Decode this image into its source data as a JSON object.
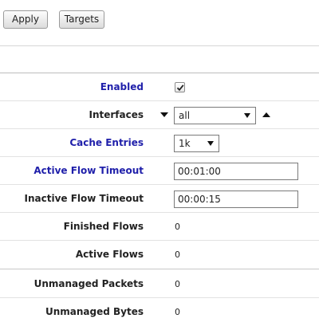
{
  "toolbar": {
    "apply_label": "Apply",
    "targets_label": "Targets"
  },
  "form": {
    "enabled": {
      "label": "Enabled",
      "checked": true
    },
    "interfaces": {
      "label": "Interfaces",
      "value": "all"
    },
    "cache_entries": {
      "label": "Cache Entries",
      "value": "1k"
    },
    "active_flow_timeout": {
      "label": "Active Flow Timeout",
      "value": "00:01:00"
    },
    "inactive_flow_timeout": {
      "label": "Inactive Flow Timeout",
      "value": "00:00:15"
    },
    "finished_flows": {
      "label": "Finished Flows",
      "value": "0"
    },
    "active_flows": {
      "label": "Active Flows",
      "value": "0"
    },
    "unmanaged_packets": {
      "label": "Unmanaged Packets",
      "value": "0"
    },
    "unmanaged_bytes": {
      "label": "Unmanaged Bytes",
      "value": "0"
    }
  },
  "colors": {
    "label_blue": "#1f1faa",
    "label_dark": "#222222"
  }
}
